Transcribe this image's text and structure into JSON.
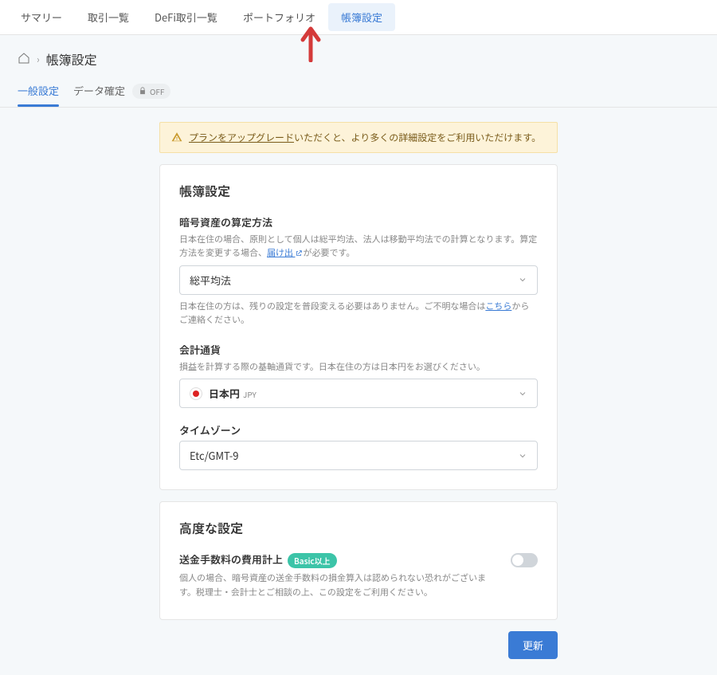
{
  "topnav": {
    "items": [
      "サマリー",
      "取引一覧",
      "DeFi取引一覧",
      "ポートフォリオ",
      "帳簿設定"
    ],
    "active_index": 4
  },
  "breadcrumb": {
    "current": "帳簿設定"
  },
  "subtabs": {
    "items": [
      "一般設定",
      "データ確定"
    ],
    "active_index": 0,
    "off_badge": "OFF"
  },
  "alert": {
    "upgrade_link": "プランをアップグレード",
    "text_after": "いただくと、より多くの詳細設定をご利用いただけます。"
  },
  "card1": {
    "title": "帳簿設定",
    "method": {
      "label": "暗号資産の算定方法",
      "desc_before": "日本在住の場合、原則として個人は総平均法、法人は移動平均法での計算となります。算定方法を変更する場合、",
      "link": "届け出",
      "desc_after": "が必要です。",
      "selected": "総平均法",
      "help_before": "日本在住の方は、残りの設定を普段変える必要はありません。ご不明な場合は",
      "help_link": "こちら",
      "help_after": "からご連絡ください。"
    },
    "currency": {
      "label": "会計通貨",
      "desc": "損益を計算する際の基軸通貨です。日本在住の方は日本円をお選びください。",
      "selected_name": "日本円",
      "selected_code": "JPY"
    },
    "timezone": {
      "label": "タイムゾーン",
      "selected": "Etc/GMT-9"
    }
  },
  "card2": {
    "title": "高度な設定",
    "fee": {
      "label": "送金手数料の費用計上",
      "plan_badge": "Basic以上",
      "desc": "個人の場合、暗号資産の送金手数料の損金算入は認められない恐れがございます。税理士・会計士とご相談の上、この設定をご利用ください。"
    }
  },
  "actions": {
    "save": "更新"
  }
}
